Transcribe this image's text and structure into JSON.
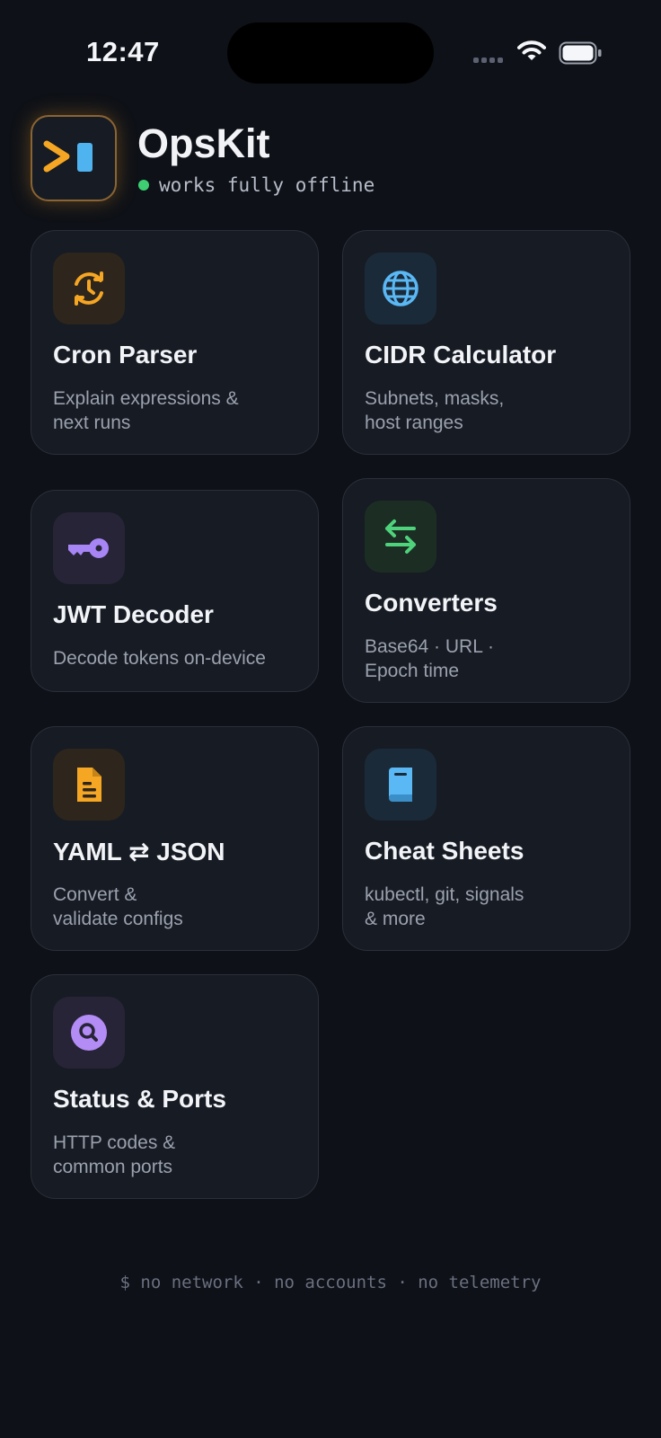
{
  "status_bar": {
    "time": "12:47"
  },
  "header": {
    "title": "OpsKit",
    "subtitle": "works fully offline"
  },
  "tools": [
    {
      "title": "Cron Parser",
      "description": "Explain expressions &\nnext runs",
      "icon": "clock-refresh-icon",
      "accent": "#f5a623"
    },
    {
      "title": "CIDR Calculator",
      "description": "Subnets, masks,\nhost ranges",
      "icon": "globe-icon",
      "accent": "#5ab8f5"
    },
    {
      "title": "JWT Decoder",
      "description": "Decode tokens on-device",
      "icon": "key-icon",
      "accent": "#a885f5"
    },
    {
      "title": "Converters",
      "description": "Base64 · URL ·\nEpoch time",
      "icon": "swap-arrows-icon",
      "accent": "#4fd27c"
    },
    {
      "title": "YAML ⇄ JSON",
      "description": "Convert &\nvalidate configs",
      "icon": "document-icon",
      "accent": "#f5a623"
    },
    {
      "title": "Cheat Sheets",
      "description": "kubectl, git, signals\n& more",
      "icon": "book-icon",
      "accent": "#5ab8f5"
    },
    {
      "title": "Status & Ports",
      "description": "HTTP codes &\ncommon ports",
      "icon": "search-icon",
      "accent": "#b38cf5"
    }
  ],
  "footer": {
    "text": "$ no network · no accounts · no telemetry"
  }
}
